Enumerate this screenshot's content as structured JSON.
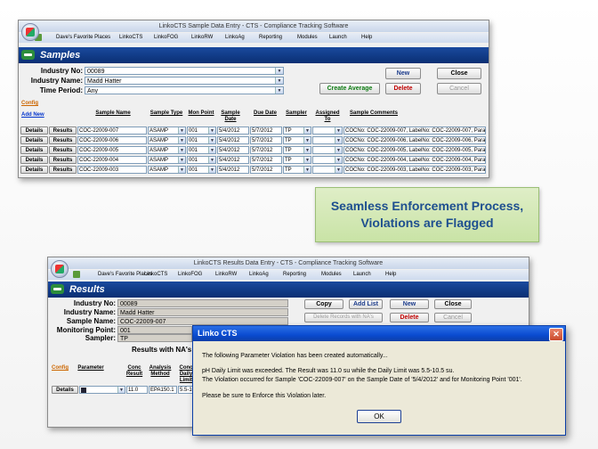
{
  "window1": {
    "title": "LinkoCTS Sample Data Entry - CTS - Compliance Tracking Software",
    "menu": [
      "Dave's Favorite Places",
      "LinkoCTS",
      "LinkoFOG",
      "LinkoRW",
      "LinkoAg",
      "Reporting",
      "Modules",
      "Launch",
      "Help"
    ],
    "banner_title": "Samples",
    "industry_no_label": "Industry No:",
    "industry_no": "00089",
    "industry_name_label": "Industry Name:",
    "industry_name": "Madd Hatter",
    "time_period_label": "Time Period:",
    "time_period": "Any",
    "btn_new": "New",
    "btn_close": "Close",
    "btn_create_average": "Create Average",
    "btn_delete": "Delete",
    "btn_cancel": "Cancel",
    "config_link": "Config",
    "add_new_link": "Add New",
    "columns": [
      "Sample Name",
      "Sample Type",
      "Mon Point",
      "Sample Date",
      "Due Date",
      "Sampler",
      "Assigned To",
      "Sample Comments"
    ],
    "details_label": "Details",
    "results_label": "Results",
    "rows": [
      {
        "name": "COC-22009-007",
        "type": "ASAMP",
        "mon": "001",
        "sdate": "5/4/2012",
        "due": "5/7/2012",
        "sampler": "TP",
        "assigned": "",
        "comments": "COCNo: COC-22009-007, LabelNo: COC-22009-007, ParamGroup:"
      },
      {
        "name": "COC-22009-006",
        "type": "ASAMP",
        "mon": "001",
        "sdate": "5/4/2012",
        "due": "5/7/2012",
        "sampler": "TP",
        "assigned": "",
        "comments": "COCNo: COC-22009-006, LabelNo: COC-22009-006, ParamGroup:"
      },
      {
        "name": "COC-22009-005",
        "type": "ASAMP",
        "mon": "001",
        "sdate": "5/4/2012",
        "due": "5/7/2012",
        "sampler": "TP",
        "assigned": "",
        "comments": "COCNo: COC-22009-005, LabelNo: COC-22009-005, ParamGroup:"
      },
      {
        "name": "COC-22009-004",
        "type": "ASAMP",
        "mon": "001",
        "sdate": "5/4/2012",
        "due": "5/7/2012",
        "sampler": "TP",
        "assigned": "",
        "comments": "COCNo: COC-22009-004, LabelNo: COC-22009-004, ParamGroup:"
      },
      {
        "name": "COC-22009-003",
        "type": "ASAMP",
        "mon": "001",
        "sdate": "5/4/2012",
        "due": "5/7/2012",
        "sampler": "TP",
        "assigned": "",
        "comments": "COCNo: COC-22009-003, LabelNo: COC-22009-003, ParamGroup:"
      }
    ]
  },
  "caption": {
    "line1": "Seamless Enforcement Process,",
    "line2": "Violations are Flagged"
  },
  "window2": {
    "title": "LinkoCTS Results Data Entry - CTS - Compliance Tracking Software",
    "menu": [
      "Dave's Favorite Places",
      "LinkoCTS",
      "LinkoFOG",
      "LinkoRW",
      "LinkoAg",
      "Reporting",
      "Modules",
      "Launch",
      "Help"
    ],
    "banner_title": "Results",
    "industry_no_label": "Industry No:",
    "industry_no": "00089",
    "industry_name_label": "Industry Name:",
    "industry_name": "Madd Hatter",
    "sample_name_label": "Sample Name:",
    "sample_name": "COC-22009-007",
    "mon_point_label": "Monitoring Point:",
    "mon_point": "001",
    "sampler_label": "Sampler:",
    "sampler": "TP",
    "sampler_trailing": "S",
    "results_na_label": "Results with NA's:",
    "btn_copy": "Copy",
    "btn_add_list": "Add List",
    "btn_new": "New",
    "btn_close": "Close",
    "btn_delete_records": "Delete Records with NA's",
    "btn_delete": "Delete",
    "btn_cancel": "Cancel",
    "config_link": "Config",
    "col_parameter": "Parameter",
    "col_conc_result": "Conc Result",
    "col_analysis_method": "Analysis Method",
    "col_conc_daily": "Conc Daily Limit",
    "row_details": "Details",
    "row_result": "11.0",
    "row_method": "EPA150.1",
    "row_limit": "5.5-10"
  },
  "dialog": {
    "title": "Linko CTS",
    "line1": "The following Parameter Violation has been created automatically...",
    "line2": "pH Daily Limit was exceeded.  The Result was 11.0 su while the Daily Limit was 5.5-10.5 su.",
    "line3": "The Violation occurred for Sample 'COC-22009-007' on the Sample Date of '5/4/2012' and for Monitoring Point '001'.",
    "line4": "Please be sure to Enforce this Violation later.",
    "ok_label": "OK"
  }
}
